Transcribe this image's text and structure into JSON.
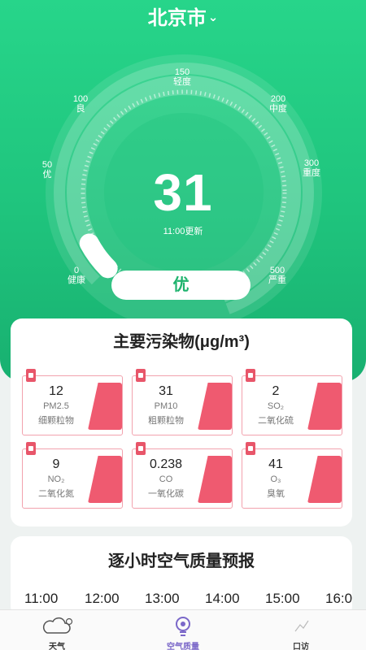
{
  "header": {
    "city": "北京市",
    "chevron_icon": "chevron-down-icon"
  },
  "gauge": {
    "value": "31",
    "value_fraction": 0.062,
    "updated": "11:00更新",
    "level": "优",
    "ticks": [
      {
        "value": "0",
        "label": "健康"
      },
      {
        "value": "50",
        "label": "优"
      },
      {
        "value": "100",
        "label": "良"
      },
      {
        "value": "150",
        "label": "轻度"
      },
      {
        "value": "200",
        "label": "中度"
      },
      {
        "value": "300",
        "label": "重度"
      },
      {
        "value": "500",
        "label": "严重"
      }
    ]
  },
  "pollutants": {
    "title": "主要污染物(μg/m³)",
    "items": [
      {
        "value": "12",
        "code": "PM2.5",
        "name": "细颗粒物"
      },
      {
        "value": "31",
        "code": "PM10",
        "name": "粗颗粒物"
      },
      {
        "value": "2",
        "code": "SO₂",
        "name": "二氧化硫"
      },
      {
        "value": "9",
        "code": "NO₂",
        "name": "二氧化氮"
      },
      {
        "value": "0.238",
        "code": "CO",
        "name": "一氧化碳"
      },
      {
        "value": "41",
        "code": "O₃",
        "name": "臭氧"
      }
    ]
  },
  "forecast": {
    "title": "逐小时空气质量预报",
    "hours": [
      "11:00",
      "12:00",
      "13:00",
      "14:00",
      "15:00",
      "16:0"
    ]
  },
  "tabbar": {
    "items": [
      {
        "label": "天气",
        "icon": "weather-cloud-icon",
        "active": false
      },
      {
        "label": "空气质量",
        "icon": "air-quality-icon",
        "active": true
      },
      {
        "label": "口访",
        "icon": "other-tab-icon",
        "active": false
      }
    ]
  },
  "colors": {
    "primary": "#1fc47d",
    "accent_pink": "#ef5a70",
    "active_tab": "#7b68c9"
  }
}
